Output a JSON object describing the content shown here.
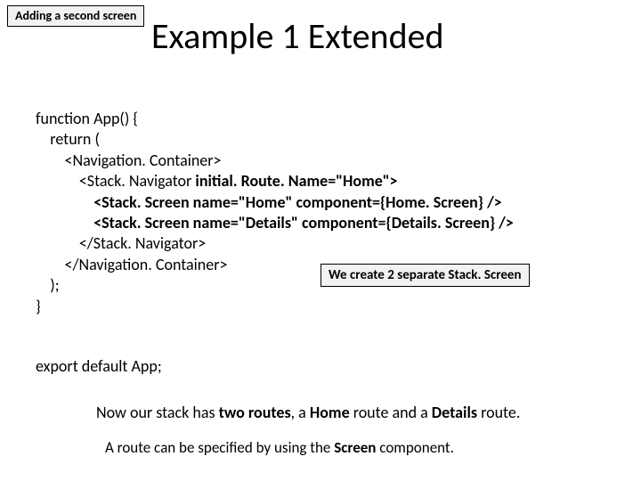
{
  "tag": "Adding a second screen",
  "title": "Example 1 Extended",
  "code": {
    "l1": "function App() {",
    "l2": "    return (",
    "l3": "        <Navigation. Container>",
    "l4p": "            <Stack. Navigator ",
    "l4b": "initial. Route. Name=\"Home\">",
    "l5p": "                ",
    "l5b": "<Stack. Screen name=\"Home\" component={Home. Screen} />",
    "l6p": "                ",
    "l6b": "<Stack. Screen name=\"Details\" component={Details. Screen} />",
    "l7": "            </Stack. Navigator>",
    "l8": "        </Navigation. Container>",
    "l9": "    );",
    "l10": "}"
  },
  "callout": "We create 2 separate Stack. Screen",
  "exportLine": "export default App;",
  "note1_a": "Now our stack has ",
  "note1_b": "two routes",
  "note1_c": ", a ",
  "note1_d": "Home ",
  "note1_e": "route and a ",
  "note1_f": "Details ",
  "note1_g": "route.",
  "note2_a": "A route can be specified by using the ",
  "note2_b": "Screen ",
  "note2_c": "component."
}
